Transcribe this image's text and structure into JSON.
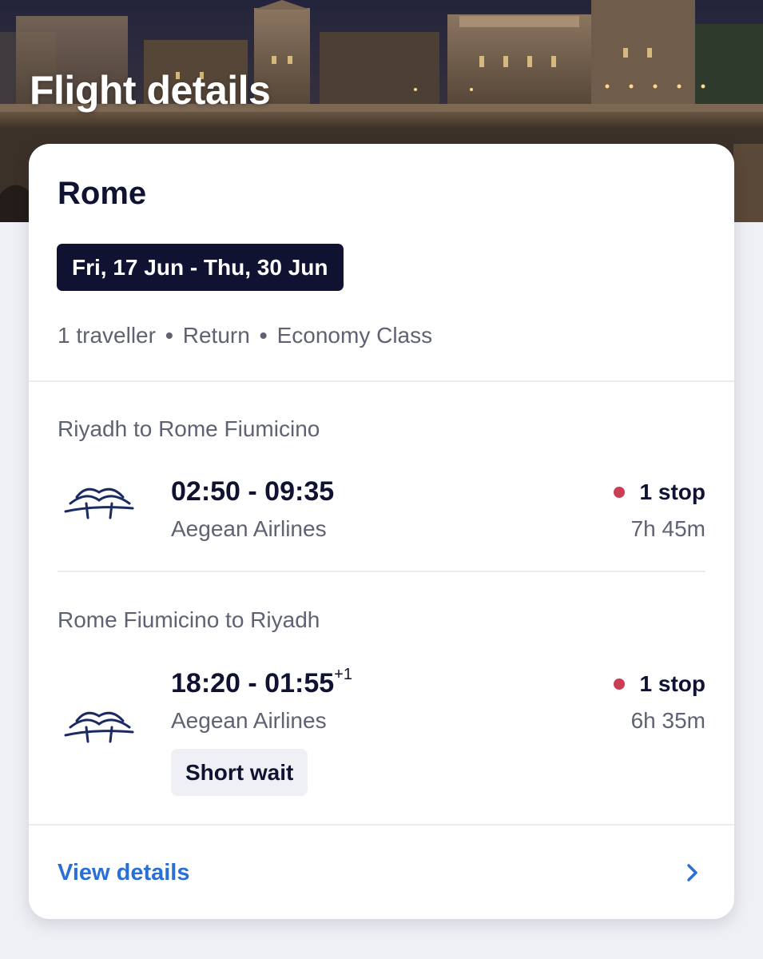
{
  "header": {
    "title": "Flight details"
  },
  "trip": {
    "destination": "Rome",
    "dates": "Fri, 17 Jun - Thu, 30 Jun",
    "travellers": "1 traveller",
    "trip_type": "Return",
    "cabin_class": "Economy Class",
    "separator": "•"
  },
  "legs": [
    {
      "route": "Riyadh to Rome Fiumicino",
      "times": "02:50 - 09:35",
      "day_offset": "",
      "airline": "Aegean Airlines",
      "stops": "1 stop",
      "duration": "7h 45m",
      "badge": ""
    },
    {
      "route": "Rome Fiumicino to Riyadh",
      "times": "18:20 - 01:55",
      "day_offset": "+1",
      "airline": "Aegean Airlines",
      "stops": "1 stop",
      "duration": "6h 35m",
      "badge": "Short wait"
    }
  ],
  "footer": {
    "view_details_label": "View details"
  },
  "icons": {
    "airline_logo": "aegean-airlines-logo",
    "stop_indicator": "red-dot",
    "chevron": "chevron-right-icon"
  },
  "colors": {
    "navy": "#101232",
    "link_blue": "#2a6fd6",
    "stop_dot": "#c93e55",
    "muted_text": "#5f6273",
    "page_background": "#eff0f5"
  }
}
